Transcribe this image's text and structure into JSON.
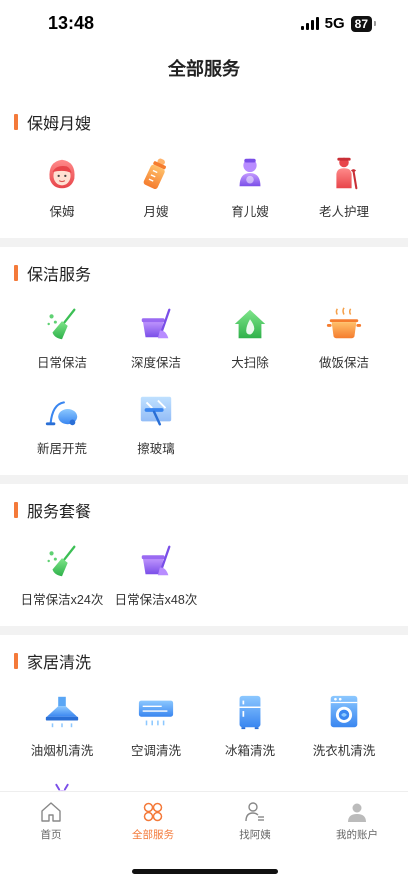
{
  "status": {
    "time": "13:48",
    "network": "5G",
    "battery": "87"
  },
  "header": {
    "title": "全部服务"
  },
  "colors": {
    "accent": "#f47a3a",
    "divider": "#f2f2f2"
  },
  "sections": [
    {
      "title": "保姆月嫂",
      "items": [
        {
          "label": "保姆",
          "icon": "nanny-icon"
        },
        {
          "label": "月嫂",
          "icon": "baby-bottle-icon"
        },
        {
          "label": "育儿嫂",
          "icon": "childcare-icon"
        },
        {
          "label": "老人护理",
          "icon": "elderly-care-icon"
        }
      ]
    },
    {
      "title": "保洁服务",
      "items": [
        {
          "label": "日常保洁",
          "icon": "broom-icon"
        },
        {
          "label": "深度保洁",
          "icon": "bucket-mop-icon"
        },
        {
          "label": "大扫除",
          "icon": "house-icon"
        },
        {
          "label": "做饭保洁",
          "icon": "cooking-pot-icon"
        },
        {
          "label": "新居开荒",
          "icon": "vacuum-icon"
        },
        {
          "label": "擦玻璃",
          "icon": "window-squeegee-icon"
        }
      ]
    },
    {
      "title": "服务套餐",
      "items": [
        {
          "label": "日常保洁x24次",
          "icon": "broom-icon"
        },
        {
          "label": "日常保洁x48次",
          "icon": "bucket-mop-icon"
        }
      ]
    },
    {
      "title": "家居清洗",
      "items": [
        {
          "label": "油烟机清洗",
          "icon": "range-hood-icon"
        },
        {
          "label": "空调清洗",
          "icon": "air-conditioner-icon"
        },
        {
          "label": "冰箱清洗",
          "icon": "fridge-icon"
        },
        {
          "label": "洗衣机清洗",
          "icon": "washing-machine-icon"
        },
        {
          "label": "",
          "icon": "pest-control-icon"
        }
      ]
    }
  ],
  "tabs": [
    {
      "label": "首页",
      "icon": "home-icon",
      "active": false
    },
    {
      "label": "全部服务",
      "icon": "all-services-icon",
      "active": true
    },
    {
      "label": "找阿姨",
      "icon": "find-helper-icon",
      "active": false
    },
    {
      "label": "我的账户",
      "icon": "account-icon",
      "active": false
    }
  ]
}
